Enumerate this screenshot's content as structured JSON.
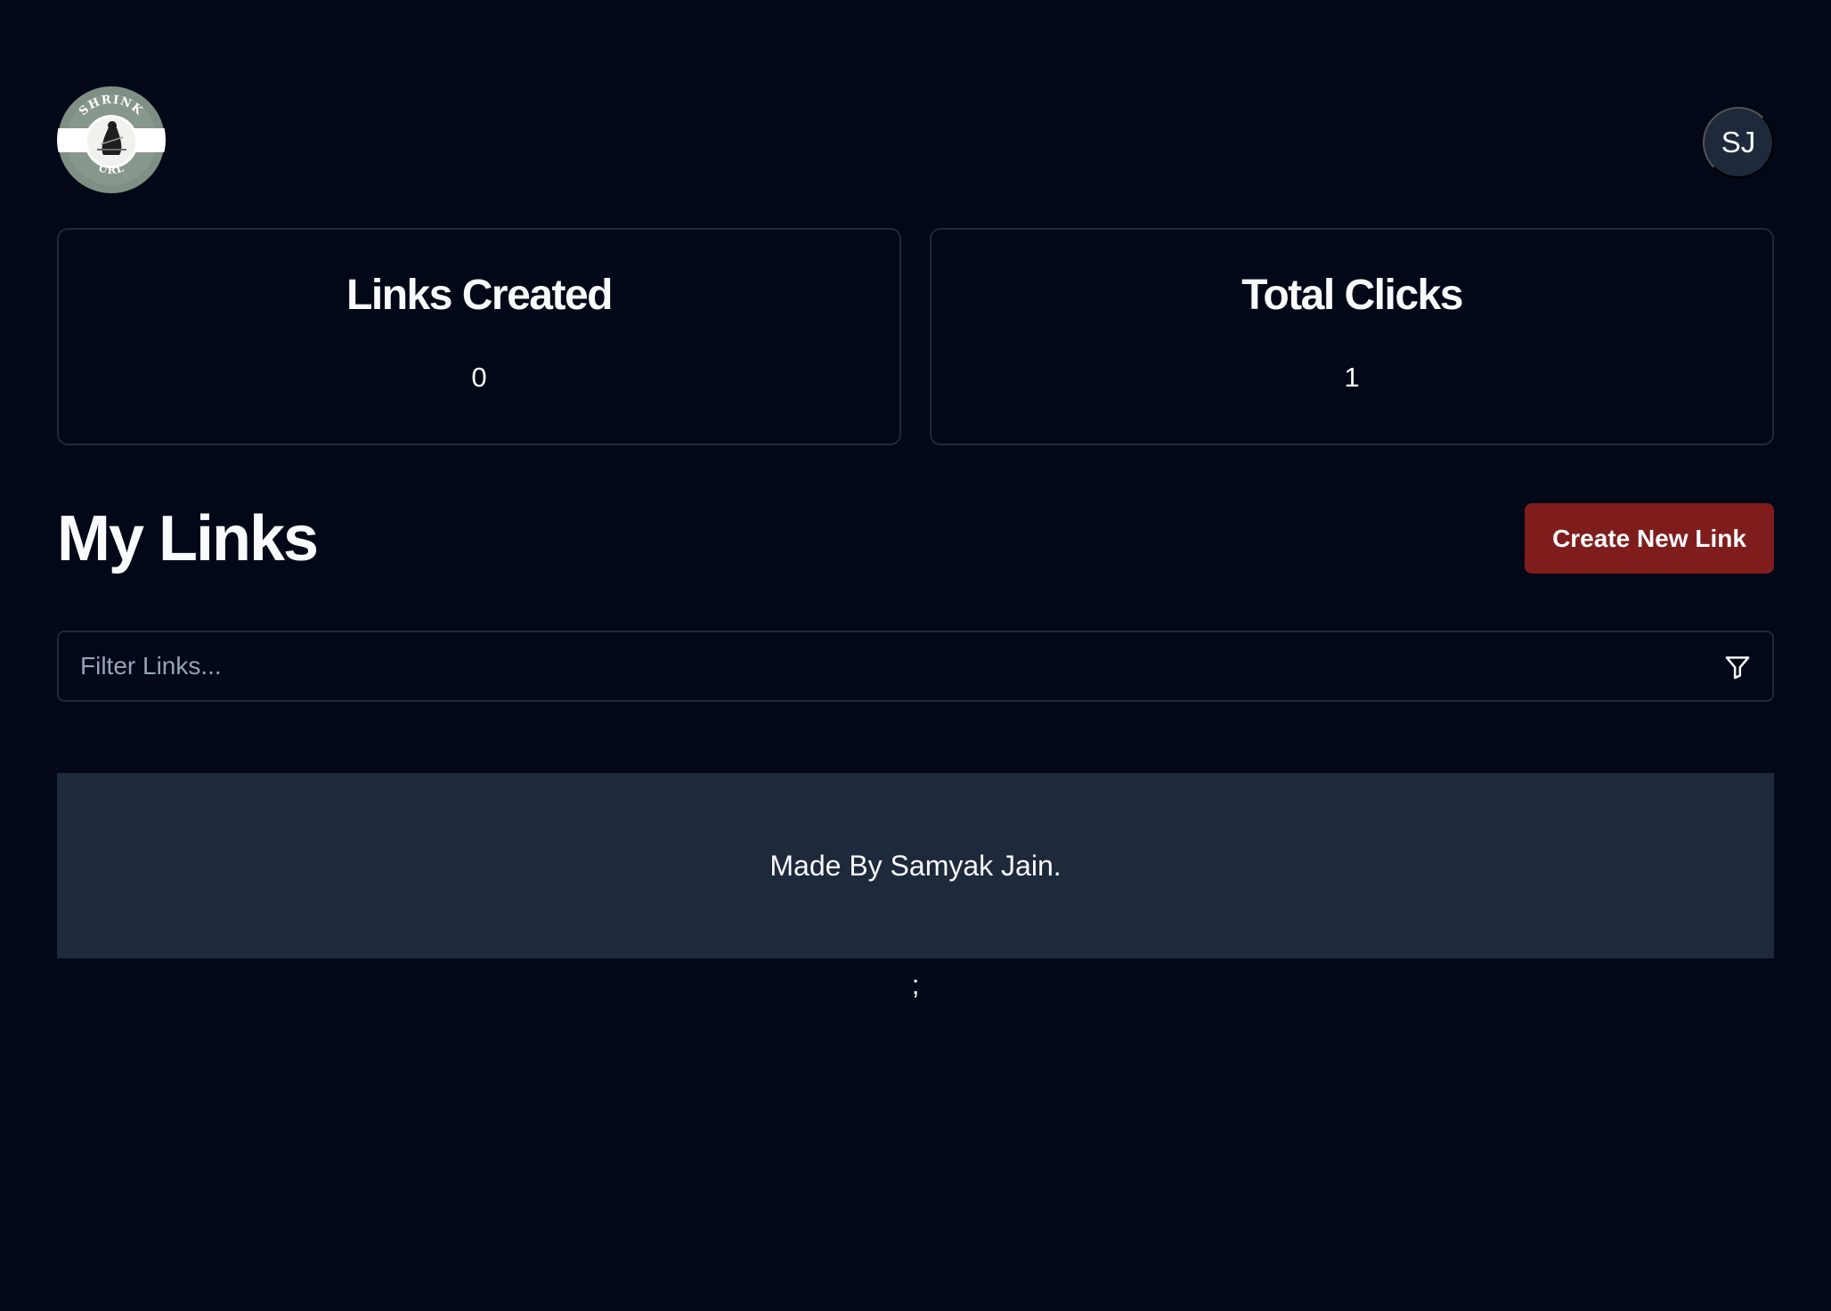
{
  "header": {
    "logo": {
      "top_text": "SHRINK",
      "bottom_text": "URL"
    },
    "avatar_initials": "SJ"
  },
  "stats": [
    {
      "label": "Links Created",
      "value": "0"
    },
    {
      "label": "Total Clicks",
      "value": "1"
    }
  ],
  "links_section": {
    "title": "My Links",
    "create_button_label": "Create New Link",
    "filter": {
      "placeholder": "Filter Links...",
      "value": "",
      "icon": "filter-icon"
    }
  },
  "footer": {
    "text": "Made By Samyak Jain."
  },
  "stray_text": ";",
  "colors": {
    "background": "#020817",
    "card_border": "#1e293b",
    "footer_background": "#1e293b",
    "primary_button": "#7f1d1d",
    "text": "#f8fafc",
    "placeholder": "#94a3b8"
  }
}
